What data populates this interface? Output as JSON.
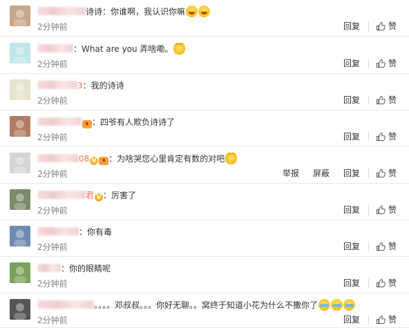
{
  "labels": {
    "reply": "回复",
    "like": "赞",
    "report": "举报",
    "block": "屏蔽"
  },
  "comments": [
    {
      "user": "",
      "user_blur_width": 70,
      "user_tail": "",
      "badges": [],
      "text": "诗诗：你谁啊，我认识你嘛",
      "emojis": [
        "laugh",
        "laugh"
      ],
      "time": "2分钟前",
      "extra_actions": false,
      "avatar": "girl-photo",
      "avatar_color": "#c9a58a"
    },
    {
      "user": "",
      "user_blur_width": 52,
      "user_tail": "",
      "badges": [],
      "text": "：What are you 弄啥嘞。",
      "emojis": [
        "cat"
      ],
      "time": "2分钟前",
      "extra_actions": false,
      "avatar": "teal-sketch",
      "avatar_color": "#bfe6e8"
    },
    {
      "user": "",
      "user_blur_width": 58,
      "user_tail": "3",
      "badges": [],
      "text": "：我的诗诗",
      "emojis": [],
      "time": "2分钟前",
      "extra_actions": false,
      "avatar": "cartoon-hat",
      "avatar_color": "#e6e2cc"
    },
    {
      "user": "",
      "user_blur_width": 64,
      "user_tail": "",
      "badges": [
        "fan"
      ],
      "text": "：四爷有人欺负诗诗了",
      "emojis": [],
      "time": "2分钟前",
      "extra_actions": false,
      "avatar": "woman-photo",
      "avatar_color": "#b07c62"
    },
    {
      "user": "",
      "user_blur_width": 60,
      "user_tail": "08",
      "badges": [
        "vip",
        "fan"
      ],
      "text": "：为啥哭您心里肯定有数的对吧",
      "emojis": [
        "cat"
      ],
      "time": "2分钟前",
      "extra_actions": true,
      "avatar": "sketch-portrait",
      "avatar_color": "#d4d4d4"
    },
    {
      "user": "",
      "user_blur_width": 70,
      "user_tail": "君",
      "badges": [
        "vip"
      ],
      "text": "：厉害了",
      "emojis": [],
      "time": "2分钟前",
      "extra_actions": false,
      "avatar": "landscape",
      "avatar_color": "#7a8a6a"
    },
    {
      "user": "",
      "user_blur_width": 60,
      "user_tail": "",
      "badges": [],
      "text": "：你有毒",
      "emojis": [],
      "time": "2分钟前",
      "extra_actions": false,
      "avatar": "city-skyline",
      "avatar_color": "#6f8ab0"
    },
    {
      "user": "",
      "user_blur_width": 34,
      "user_tail": "",
      "badges": [],
      "text": "：你的眼睛呢",
      "emojis": [],
      "time": "2分钟前",
      "extra_actions": false,
      "avatar": "child-photo",
      "avatar_color": "#7aa05a"
    },
    {
      "user": "",
      "user_blur_width": 82,
      "user_tail": "",
      "badges": [],
      "text": "。。。。邓叔叔。。。你好无聊。。窝终于知道小花为什么不撒你了",
      "emojis": [
        "cry",
        "cry",
        "cry"
      ],
      "time": "2分钟前",
      "extra_actions": false,
      "avatar": "dark-portrait",
      "avatar_color": "#555555"
    }
  ]
}
